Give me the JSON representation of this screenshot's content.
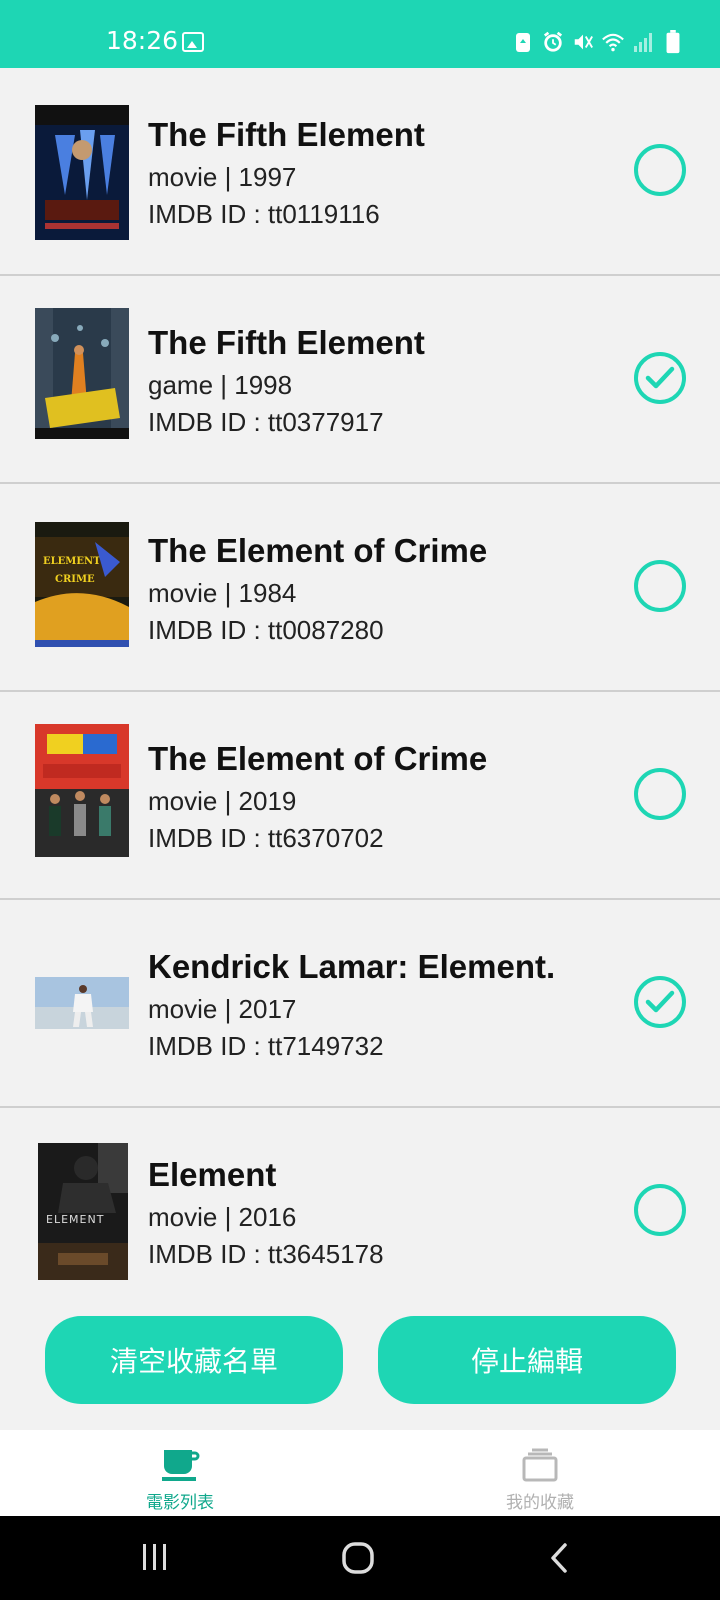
{
  "status_bar": {
    "time": "18:26",
    "icons": [
      "image-icon",
      "battery-saver-icon",
      "alarm-icon",
      "mute-icon",
      "wifi-icon",
      "signal-icon",
      "battery-icon"
    ]
  },
  "movies": [
    {
      "title": "The Fifth Element",
      "meta": "movie | 1997",
      "imdb": "IMDB ID : tt0119116",
      "favorited": false
    },
    {
      "title": "The Fifth Element",
      "meta": "game | 1998",
      "imdb": "IMDB ID : tt0377917",
      "favorited": true
    },
    {
      "title": "The Element of Crime",
      "meta": "movie | 1984",
      "imdb": "IMDB ID : tt0087280",
      "favorited": false
    },
    {
      "title": "The Element of Crime",
      "meta": "movie | 2019",
      "imdb": "IMDB ID : tt6370702",
      "favorited": false
    },
    {
      "title": "Kendrick Lamar: Element.",
      "meta": "movie | 2017",
      "imdb": "IMDB ID : tt7149732",
      "favorited": true
    },
    {
      "title": "Element",
      "meta": "movie | 2016",
      "imdb": "IMDB ID : tt3645178",
      "favorited": false
    }
  ],
  "actions": {
    "clear_label": "清空收藏名單",
    "stop_label": "停止編輯"
  },
  "tabs": [
    {
      "label": "電影列表",
      "icon": "coffee-cup-icon",
      "active": true
    },
    {
      "label": "我的收藏",
      "icon": "stack-icon",
      "active": false
    }
  ],
  "colors": {
    "accent": "#1ed6b4",
    "active_tab": "#10a88c",
    "inactive_tab": "#b0b0b0"
  }
}
